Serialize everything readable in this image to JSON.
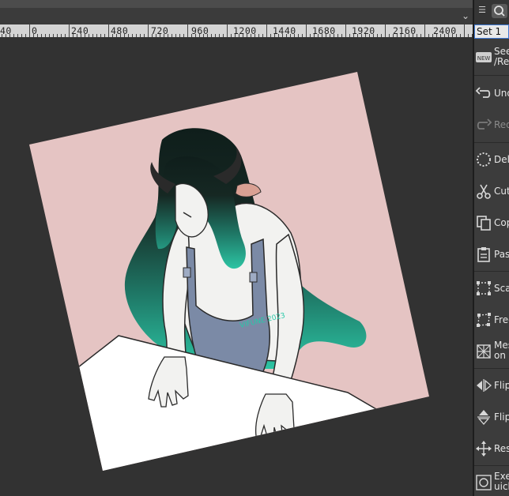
{
  "ruler": {
    "labels": [
      "40",
      "0",
      "240",
      "480",
      "720",
      "960",
      "1200",
      "1440",
      "1680",
      "1920",
      "2160",
      "2400"
    ]
  },
  "panel": {
    "set_label": "Set 1",
    "commands": [
      {
        "label": "See\n/Re",
        "icon": "new-badge-icon",
        "enabled": true
      },
      {
        "label": "Und",
        "icon": "undo-icon",
        "enabled": true
      },
      {
        "label": "Red",
        "icon": "redo-icon",
        "enabled": false
      },
      {
        "label": "Dele",
        "icon": "delete-icon",
        "enabled": true
      },
      {
        "label": "Cut",
        "icon": "scissors-icon",
        "enabled": true
      },
      {
        "label": "Cop",
        "icon": "copy-icon",
        "enabled": true
      },
      {
        "label": "Past",
        "icon": "paste-icon",
        "enabled": true
      },
      {
        "label": "Sca",
        "icon": "scale-icon",
        "enabled": true
      },
      {
        "label": "Free",
        "icon": "free-transform-icon",
        "enabled": true
      },
      {
        "label": "Mes\non",
        "icon": "mesh-transform-icon",
        "enabled": true
      },
      {
        "label": "Flip",
        "icon": "flip-horizontal-icon",
        "enabled": true
      },
      {
        "label": "Flip",
        "icon": "flip-vertical-icon",
        "enabled": true
      },
      {
        "label": "Res",
        "icon": "resize-icon",
        "enabled": true
      },
      {
        "label": "Exec\nuick",
        "icon": "execute-icon",
        "enabled": true
      }
    ]
  },
  "artwork": {
    "signature": "VIFUNE 2023",
    "colors": {
      "background_pink": "#e5c4c3",
      "table": "#ffffff",
      "skin": "#f2f2f0",
      "overalls": "#7b8aa6",
      "hair_dark": "#162823",
      "hair_teal": "#27b698",
      "horn": "#2a2a2a",
      "ear": "#d9a093"
    }
  }
}
